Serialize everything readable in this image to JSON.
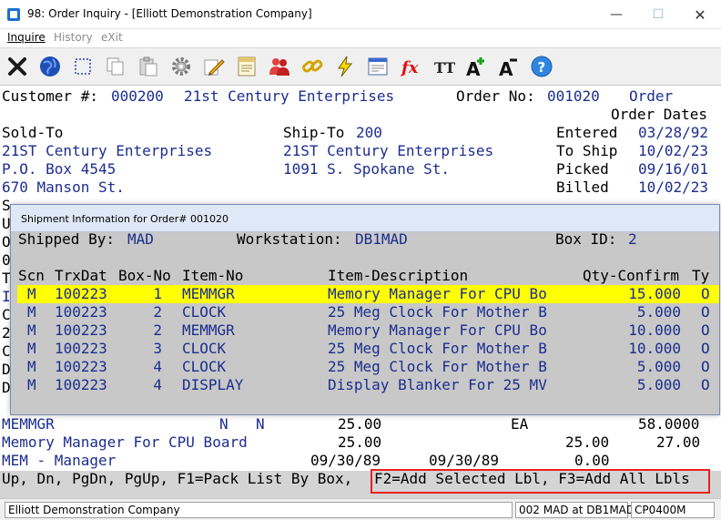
{
  "window": {
    "title": "98: Order Inquiry - [Elliott Demonstration Company]",
    "minimize": "—",
    "maximize": "☐",
    "close": "✕"
  },
  "menu": [
    {
      "label": "Inquire",
      "enabled": true
    },
    {
      "label": "History",
      "enabled": false
    },
    {
      "label": "eXit",
      "enabled": false
    }
  ],
  "toolbar": {
    "icons": [
      "exit-icon",
      "globe-icon",
      "select-icon",
      "copy-icon",
      "paste-icon",
      "settings-icon",
      "edit-icon",
      "notes-icon",
      "users-icon",
      "link-icon",
      "lightning-icon",
      "form-icon",
      "function-icon",
      "font-icon",
      "font-increase-icon",
      "font-decrease-icon",
      "help-icon"
    ],
    "fx_label": "fx",
    "tt_label": "TT",
    "a_label": "A",
    "help_label": "?"
  },
  "order": {
    "customer_label": "Customer #:",
    "customer_no": "000200",
    "customer_name": "21st Century Enterprises",
    "order_no_label": "Order No:",
    "order_no": "001020",
    "order_label": "Order",
    "order_dates_label": "Order Dates",
    "sold_to_label": "Sold-To",
    "ship_to_label": "Ship-To",
    "ship_to_code": "200",
    "sold_to_lines": [
      "21ST Century Enterprises",
      "P.O. Box 4545",
      "670 Manson St."
    ],
    "ship_to_lines": [
      "21ST Century Enterprises",
      "1091 S. Spokane St."
    ],
    "dates": [
      {
        "label": "Entered",
        "value": "03/28/92"
      },
      {
        "label": "To Ship",
        "value": "10/02/23"
      },
      {
        "label": "Picked",
        "value": "09/16/01"
      },
      {
        "label": "Billed",
        "value": "10/02/23"
      }
    ],
    "left_edge_chars": [
      "S",
      "U",
      "O",
      "0",
      "T",
      "I",
      "C",
      "2",
      "C",
      "D",
      "D"
    ]
  },
  "line_detail": {
    "row1": {
      "item": "MEMMGR",
      "n1": "N",
      "n2": "N",
      "qty": "25.00",
      "uom": "EA",
      "price": "58.0000"
    },
    "row2": {
      "desc": "Memory Manager For CPU Board",
      "qty": "25.00",
      "v1": "25.00",
      "v2": "27.00"
    },
    "row3": {
      "desc": "MEM - Manager",
      "date1": "09/30/89",
      "date2": "09/30/89",
      "v": "0.00"
    }
  },
  "fkeys": {
    "left": "Up, Dn, PgDn, PgUp, F1=Pack List By Box,",
    "right": "F2=Add Selected Lbl, F3=Add All Lbls"
  },
  "dialog": {
    "title": "Shipment Information for Order# 001020",
    "shipped_by_label": "Shipped By:",
    "shipped_by": "MAD",
    "workstation_label": "Workstation:",
    "workstation": "DB1MAD",
    "box_id_label": "Box ID:",
    "box_id": "2",
    "columns": [
      "Scn",
      "TrxDat",
      "Box-No",
      "Item-No",
      "Item-Description",
      "Qty-Confirm",
      "Ty"
    ],
    "rows": [
      {
        "scn": "M",
        "date": "100223",
        "box": "1",
        "item": "MEMMGR",
        "desc": "Memory Manager For CPU Bo",
        "qty": "15.000",
        "ty": "O"
      },
      {
        "scn": "M",
        "date": "100223",
        "box": "2",
        "item": "CLOCK",
        "desc": "25 Meg Clock For Mother B",
        "qty": "5.000",
        "ty": "O"
      },
      {
        "scn": "M",
        "date": "100223",
        "box": "2",
        "item": "MEMMGR",
        "desc": "Memory Manager For CPU Bo",
        "qty": "10.000",
        "ty": "O"
      },
      {
        "scn": "M",
        "date": "100223",
        "box": "3",
        "item": "CLOCK",
        "desc": "25 Meg Clock For Mother B",
        "qty": "10.000",
        "ty": "O"
      },
      {
        "scn": "M",
        "date": "100223",
        "box": "4",
        "item": "CLOCK",
        "desc": "25 Meg Clock For Mother B",
        "qty": "5.000",
        "ty": "O"
      },
      {
        "scn": "M",
        "date": "100223",
        "box": "4",
        "item": "DISPLAY",
        "desc": "Display Blanker For 25 MV",
        "qty": "5.000",
        "ty": "O"
      }
    ]
  },
  "status": {
    "company": "Elliott Demonstration Company",
    "user": "002 MAD at DB1MAD",
    "program": "CP0400M"
  },
  "colors": {
    "text_blue": "#1c2d8f",
    "highlight": "#ffff00",
    "dialog_bg": "#c8c8c8",
    "box_red": "#e8201f"
  }
}
